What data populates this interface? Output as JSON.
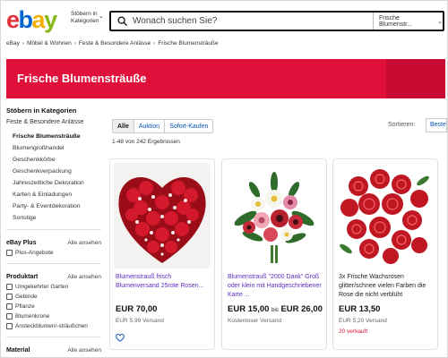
{
  "header": {
    "logo": {
      "e": "e",
      "b": "b",
      "a": "a",
      "y": "y"
    },
    "browse_label": "Stöbern in Kategorien",
    "search_placeholder": "Wonach suchen Sie?",
    "category_select": "Frische Blumenstr..."
  },
  "breadcrumb": [
    "eBay",
    "Möbel & Wohnen",
    "Feste & Besondere Anlässe",
    "Frische Blumensträuße"
  ],
  "banner": {
    "title": "Frische Blumensträuße",
    "color": "#e0103a"
  },
  "sidebar": {
    "heading": "Stöbern in Kategorien",
    "parent": "Feste & Besondere Anlässe",
    "items": [
      {
        "label": "Frische Blumensträuße",
        "active": true
      },
      {
        "label": "Blumengroßhandel"
      },
      {
        "label": "Geschenkkörbe"
      },
      {
        "label": "Geschenkverpackung"
      },
      {
        "label": "Jahreszeitliche Dekoration"
      },
      {
        "label": "Karten & Einladungen"
      },
      {
        "label": "Party- & Eventdekoration"
      },
      {
        "label": "Sonstige"
      }
    ],
    "ebay_plus": {
      "title": "eBay Plus",
      "link": "Alle ansehen",
      "options": [
        "Plus-Angebote"
      ]
    },
    "produktart": {
      "title": "Produktart",
      "link": "Alle ansehen",
      "options": [
        "Umgekehrter Garten",
        "Gebinde",
        "Pflanze",
        "Blumenkrone",
        "Ansteckblumen/-sträußchen"
      ]
    },
    "material": {
      "title": "Material",
      "link": "Alle ansehen"
    }
  },
  "filters": [
    "Alle",
    "Auktion",
    "Sofort-Kaufen"
  ],
  "sort": {
    "label": "Sortieren:",
    "value": "Beste"
  },
  "results": "1-48 von 242 Ergebnissen",
  "listings": [
    {
      "title": "Blumenstrauß frisch Blumenversand 25rote Rosen...",
      "price": "EUR 70,00",
      "shipping": "EUR 5,99 Versand",
      "title_color": "#5b2dc4"
    },
    {
      "title": "Blumenstrauß \"2000 Dank\" Groß oder klein mit Handgeschriebener Karte ...",
      "price_from": "EUR 15,00",
      "price_sep": "bis",
      "price_to": "EUR 26,00",
      "shipping": "Kostenloser Versand",
      "title_color": "#5b2dc4"
    },
    {
      "title": "3x Frische Wachsrosen glitter/schnee vielen Farben die Rose die nicht verblüht",
      "price": "EUR 13,50",
      "shipping": "EUR 5,20 Versand",
      "sold": "20 verkauft",
      "title_color": "#222"
    }
  ]
}
